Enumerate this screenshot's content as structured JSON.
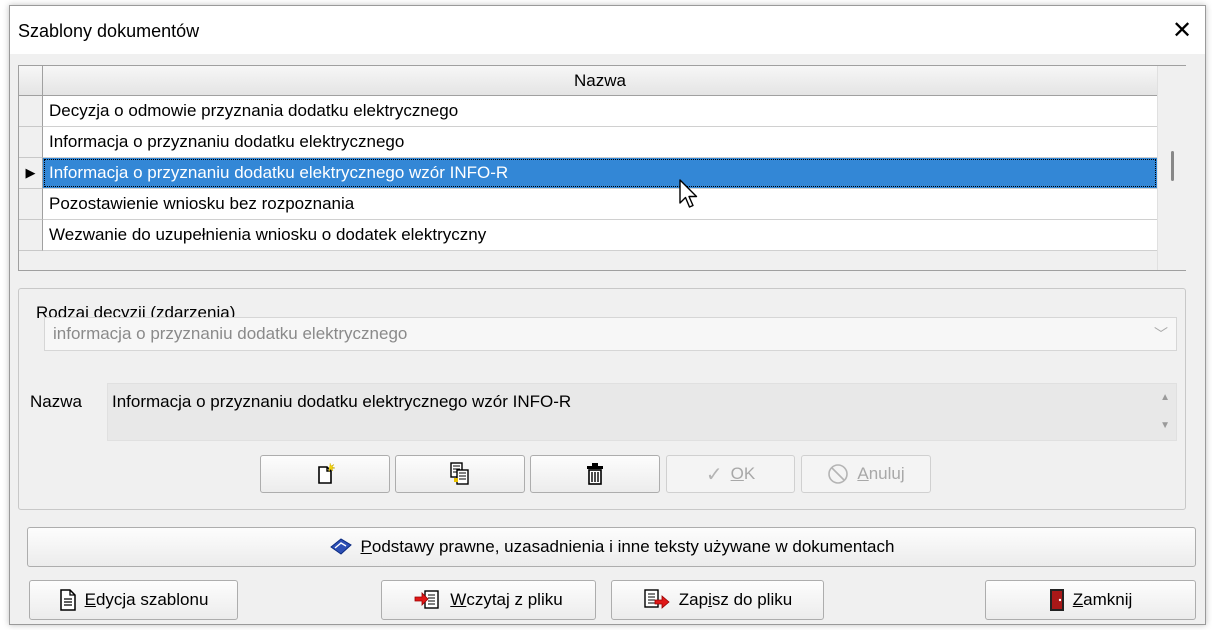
{
  "window": {
    "title": "Szablony dokumentów",
    "close_glyph": "✕"
  },
  "grid": {
    "column_header": "Nazwa",
    "rows": [
      {
        "text": "Decyzja o odmowie przyznania dodatku elektrycznego",
        "indicator": ""
      },
      {
        "text": "Informacja o przyznaniu dodatku elektrycznego",
        "indicator": ""
      },
      {
        "text": "Informacja o przyznaniu dodatku elektrycznego wzór INFO-R",
        "indicator": "▶"
      },
      {
        "text": "Pozostawienie wniosku bez rozpoznania",
        "indicator": ""
      },
      {
        "text": "Wezwanie do uzupełnienia wniosku o dodatek elektryczny",
        "indicator": ""
      }
    ],
    "selected_index": 2
  },
  "details": {
    "group_label": "Rodzaj decyzji (zdarzenia)",
    "decision_type_value": "informacja o przyznaniu dodatku elektrycznego",
    "name_label": "Nazwa",
    "name_value": "Informacja o przyznaniu dodatku elektrycznego wzór INFO-R"
  },
  "toolbar": {
    "new_icon": "new-document-icon",
    "copy_icon": "copy-document-icon",
    "delete_icon": "trash-icon",
    "ok_key": "O",
    "ok_rest": "K",
    "cancel_key": "A",
    "cancel_rest": "nuluj"
  },
  "bottom": {
    "legal_key": "P",
    "legal_rest": "odstawy prawne, uzasadnienia i inne teksty używane w dokumentach",
    "edit_key": "E",
    "edit_rest": "dycja szablonu",
    "load_key": "W",
    "load_rest": "czytaj z pliku",
    "save_pre": "Zap",
    "save_key": "i",
    "save_rest": "sz do pliku",
    "close_key": "Z",
    "close_rest": "amknij"
  },
  "colors": {
    "selection": "#3387d6",
    "window_bg": "#f0f0f0"
  }
}
